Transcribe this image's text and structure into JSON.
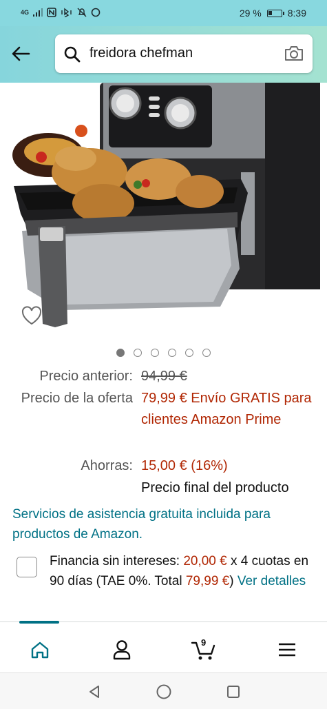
{
  "status": {
    "network": "4G",
    "battery_percent": "29 %",
    "battery_level": 0.29,
    "time": "8:39"
  },
  "search": {
    "query": "freidora chefman",
    "placeholder": ""
  },
  "carousel": {
    "total": 6,
    "active_index": 0
  },
  "price": {
    "previous_label": "Precio anterior:",
    "previous_value": "94,99 €",
    "offer_label": "Precio de la oferta",
    "offer_value": "79,99 €",
    "offer_shipping": " Envío GRATIS para clientes Amazon Prime",
    "savings_label": "Ahorras:",
    "savings_value": "15,00 € (16%)",
    "final_note": "Precio final del producto"
  },
  "services_text": "Servicios de asistencia gratuita incluida para productos de Amazon.",
  "financing": {
    "text_1": "Financia sin intereses: ",
    "amount": "20,00 €",
    "text_2": " x 4 cuotas en 90 días (TAE 0%. Total ",
    "total": "79,99 €",
    "text_3": ") ",
    "details_link": "Ver detalles"
  },
  "bottom_nav": {
    "cart_count": "9",
    "active_item": "home"
  },
  "colors": {
    "header_start": "#86d5dc",
    "header_end": "#a4e2d1",
    "price_red": "#b12704",
    "link_teal": "#007185"
  }
}
